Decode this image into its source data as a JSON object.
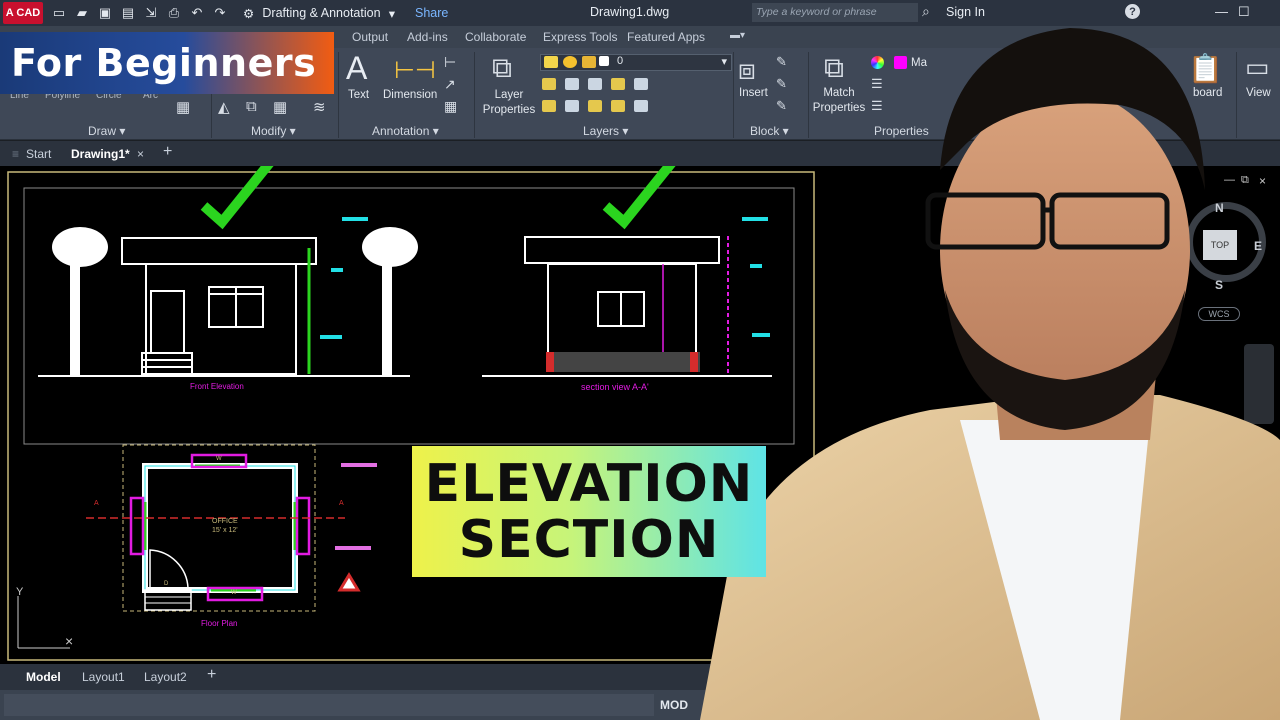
{
  "window": {
    "app_logo": "A CAD",
    "workspace": "Drafting & Annotation",
    "share": "Share",
    "doc_title": "Drawing1.dwg",
    "search_placeholder": "Type a keyword or phrase",
    "sign_in": "Sign In"
  },
  "ribbon": {
    "tabs": [
      "Output",
      "Add-ins",
      "Collaborate",
      "Express Tools",
      "Featured Apps"
    ],
    "draw_hidden_labels": [
      "Line",
      "Polyline",
      "Circle",
      "Arc"
    ],
    "panels": [
      "Draw",
      "Modify",
      "Annotation",
      "Layers",
      "Block",
      "Properties"
    ],
    "text": "Text",
    "dimension": "Dimension",
    "layer_properties": [
      "Layer",
      "Properties"
    ],
    "layer_value": "0",
    "insert": "Insert",
    "match_properties": [
      "Match",
      "Properties"
    ],
    "clipboard": "board",
    "view": "View",
    "color_label": "Ma"
  },
  "file_tabs": [
    "Start",
    "Drawing1*"
  ],
  "drawing": {
    "front_label": "Front Elevation",
    "section_label": "section view A-A'",
    "plan_label": "Floor Plan",
    "room_name": "OFFICE",
    "room_size": "15' x 12'",
    "window_tag": "W",
    "door_tag": "D",
    "cut_marker": "A",
    "y_axis": "Y",
    "compass": {
      "n": "N",
      "e": "E",
      "s": "S",
      "top": "TOP",
      "wcs": "WCS"
    }
  },
  "layout_tabs": [
    "Model",
    "Layout1",
    "Layout2"
  ],
  "status": {
    "mode": "MOD"
  },
  "overlay": {
    "badge": "For Beginners",
    "title_line1": "ELEVATION",
    "title_line2": "SECTION"
  },
  "colors": {
    "accent_orange": "#f25c12",
    "badge_blue": "#1a3a78",
    "check_green": "#2bd51f",
    "cad_magenta": "#e21ce2",
    "cad_cyan": "#22e0e6"
  }
}
